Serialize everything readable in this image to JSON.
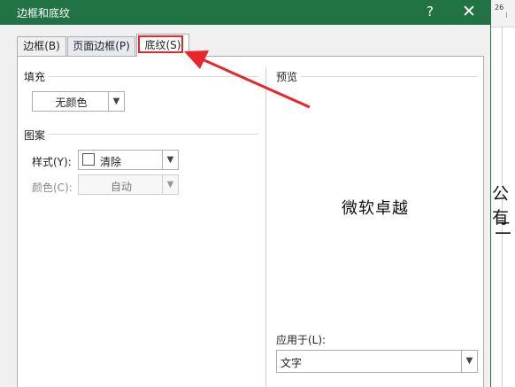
{
  "background_doc": {
    "ruler_number": "26",
    "text_line1": "公有",
    "text_line2": "二"
  },
  "dialog": {
    "title": "边框和底纹",
    "help_label": "?",
    "close_label": "✕",
    "tabs": [
      {
        "label": "边框(B)",
        "active": false
      },
      {
        "label": "页面边框(P)",
        "active": false
      },
      {
        "label": "底纹(S)",
        "active": true
      }
    ],
    "fill": {
      "group_label": "填充",
      "value": "无颜色"
    },
    "pattern": {
      "group_label": "图案",
      "style_label": "样式(Y):",
      "style_value": "清除",
      "color_label": "颜色(C):",
      "color_value": "自动"
    },
    "preview": {
      "group_label": "预览",
      "sample_text": "微软卓越"
    },
    "apply_to": {
      "label": "应用于(L):",
      "value": "文字"
    }
  },
  "annotation": {
    "highlight_color": "#e8262a"
  },
  "colors": {
    "titlebar": "#217346"
  },
  "icons": [
    "help-icon",
    "close-icon",
    "chevron-down-icon",
    "red-arrow-annotation"
  ]
}
